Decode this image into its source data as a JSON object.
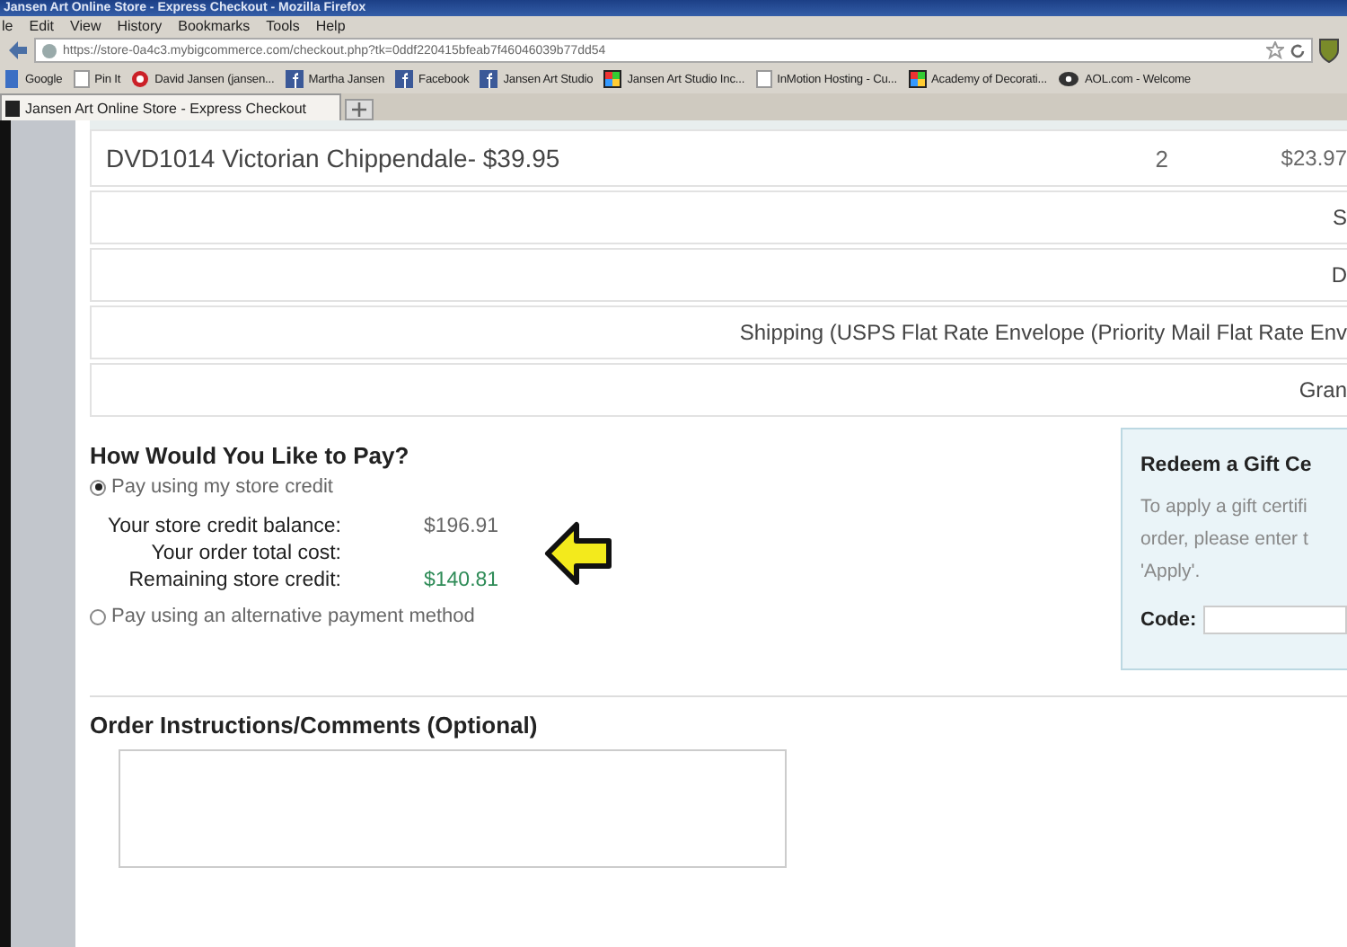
{
  "window": {
    "title": "Jansen Art Online Store - Express Checkout - Mozilla Firefox"
  },
  "menu": [
    "le",
    "Edit",
    "View",
    "History",
    "Bookmarks",
    "Tools",
    "Help"
  ],
  "address_bar": {
    "url": "https://store-0a4c3.mybigcommerce.com/checkout.php?tk=0ddf220415bfeab7f46046039b77dd54"
  },
  "bookmarks": [
    {
      "label": "Google",
      "kind": "site"
    },
    {
      "label": "Pin It",
      "kind": "page"
    },
    {
      "label": "David Jansen (jansen...",
      "kind": "pin"
    },
    {
      "label": "Martha Jansen",
      "kind": "facebook"
    },
    {
      "label": "Facebook",
      "kind": "facebook"
    },
    {
      "label": "Jansen Art Studio",
      "kind": "facebook"
    },
    {
      "label": "Jansen Art Studio Inc...",
      "kind": "app"
    },
    {
      "label": "InMotion Hosting - Cu...",
      "kind": "page"
    },
    {
      "label": "Academy of Decorati...",
      "kind": "app"
    },
    {
      "label": "AOL.com - Welcome",
      "kind": "aol"
    }
  ],
  "tabs": [
    {
      "label": "Jansen Art Online Store - Express Checkout",
      "selected": true
    }
  ],
  "order_table": {
    "rows": [
      {
        "kind": "item",
        "cells": [
          "DVD1014 Victorian Chippendale- $39.95",
          "2",
          "$23.97"
        ]
      },
      {
        "kind": "total",
        "cells": [
          "S"
        ]
      },
      {
        "kind": "total",
        "cells": [
          "D"
        ]
      },
      {
        "kind": "total",
        "cells": [
          "Shipping (USPS Flat Rate Envelope (Priority Mail Flat Rate Env"
        ]
      },
      {
        "kind": "total",
        "cells": [
          "Gran"
        ]
      }
    ]
  },
  "payment": {
    "heading": "How Would You Like to Pay?",
    "options": [
      {
        "label": "Pay using my store credit",
        "selected": true
      },
      {
        "label": "Pay using an alternative payment method",
        "selected": false
      }
    ],
    "credit_lines": [
      {
        "label": "Your store credit balance:",
        "value": "$196.91",
        "color": "#666666"
      },
      {
        "label": "Your order total cost:"
      },
      {
        "label": "Remaining store credit:",
        "value": "$140.81",
        "color": "#2e8b57"
      }
    ]
  },
  "gift_certificate": {
    "title": "Redeem a Gift Ce",
    "lines": [
      "To apply a gift certifi",
      "order, please enter t",
      "'Apply'."
    ],
    "code_label": "Code:"
  },
  "comments": {
    "heading": "Order Instructions/Comments (Optional)"
  }
}
